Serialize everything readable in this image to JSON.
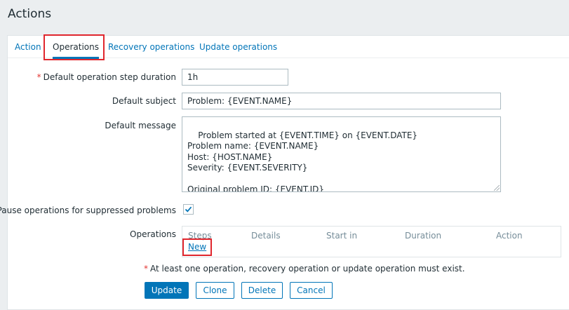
{
  "page": {
    "title": "Actions"
  },
  "tabs": [
    {
      "label": "Action"
    },
    {
      "label": "Operations"
    },
    {
      "label": "Recovery operations"
    },
    {
      "label": "Update operations"
    }
  ],
  "form": {
    "step_duration": {
      "label": "Default operation step duration",
      "required_mark": "*",
      "value": "1h"
    },
    "subject": {
      "label": "Default subject",
      "value": "Problem: {EVENT.NAME}"
    },
    "message": {
      "label": "Default message",
      "value": "Problem started at {EVENT.TIME} on {EVENT.DATE}\nProblem name: {EVENT.NAME}\nHost: {HOST.NAME}\nSeverity: {EVENT.SEVERITY}\n\nOriginal problem ID: {EVENT.ID}\n{TRIGGER.URL}"
    },
    "pause": {
      "label": "Pause operations for suppressed problems",
      "checked": true
    },
    "operations": {
      "label": "Operations",
      "columns": [
        "Steps",
        "Details",
        "Start in",
        "Duration",
        "Action"
      ],
      "new_link": "New"
    },
    "warning": {
      "mark": "*",
      "text": "At least one operation, recovery operation or update operation must exist."
    }
  },
  "buttons": {
    "update": "Update",
    "clone": "Clone",
    "delete": "Delete",
    "cancel": "Cancel"
  },
  "colors": {
    "accent": "#0275b8",
    "highlight": "#e0262d",
    "required": "#e33734"
  }
}
